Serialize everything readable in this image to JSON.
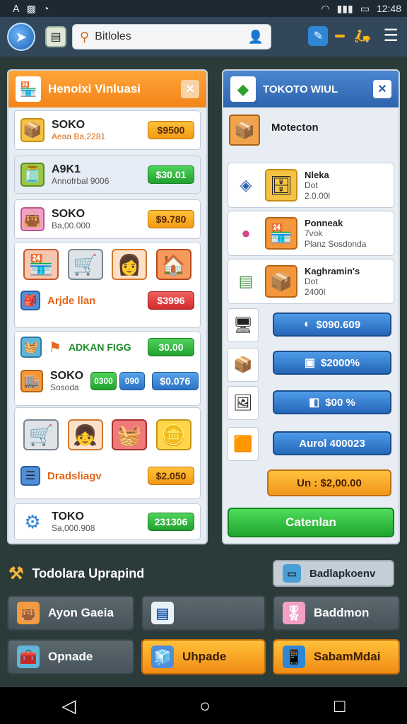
{
  "status": {
    "left_icons": [
      "𝖠",
      "▩",
      "◔"
    ],
    "time": "12:48"
  },
  "topbar": {
    "search_value": "Bitloles"
  },
  "left_panel": {
    "title": "Henoixi Vinluasi",
    "items": [
      {
        "title": "SOKO",
        "subtitle": "Aeaa Ba,2281",
        "price": "$9500"
      },
      {
        "title": "A9K1",
        "subtitle": "Annofrbal 9006",
        "price": "$30.01"
      },
      {
        "title": "SOKO",
        "subtitle": "Ba,00.000",
        "price": "$9.780"
      }
    ],
    "scene1_label": "Arjde llan",
    "scene1_price": "$3996",
    "promo_label": "ADKAN FIGG",
    "promo_price": "30.00",
    "soko2": {
      "title": "SOKO",
      "subtitle": "Sosoda",
      "pill1": "0300",
      "pill2": "090",
      "price": "$0.076"
    },
    "scene2_label": "Dradsliagv",
    "scene2_price": "$2.050",
    "toko": {
      "title": "TOKO",
      "subtitle": "Sa,000.908",
      "price": "231306"
    }
  },
  "right_panel": {
    "title": "TOKOTO WIUL",
    "feature": "Motecton",
    "items": [
      {
        "title": "Nleka",
        "line2": "Dot",
        "line3": "2.0.00l"
      },
      {
        "title": "Ponneak",
        "line2": "7vok",
        "line3": "Planz Sosdonda"
      },
      {
        "title": "Kaghramin's",
        "line2": "Dot",
        "line3": "2400l"
      }
    ],
    "buttons": [
      "$090.609",
      "$2000%",
      "$00 %",
      "Aurol  400023"
    ],
    "orange_btn": "Un  : $2,00.00",
    "checkout": "Catenlan"
  },
  "bottom": {
    "title": "Todolara Uprapind",
    "top_right": "Badlapkoenv",
    "buttons": [
      {
        "label": "Ayon Gaeia"
      },
      {
        "label": ""
      },
      {
        "label": "Baddmon"
      },
      {
        "label": "Opnade"
      },
      {
        "label": "Uhpade"
      },
      {
        "label": "SabamMdai"
      }
    ]
  }
}
